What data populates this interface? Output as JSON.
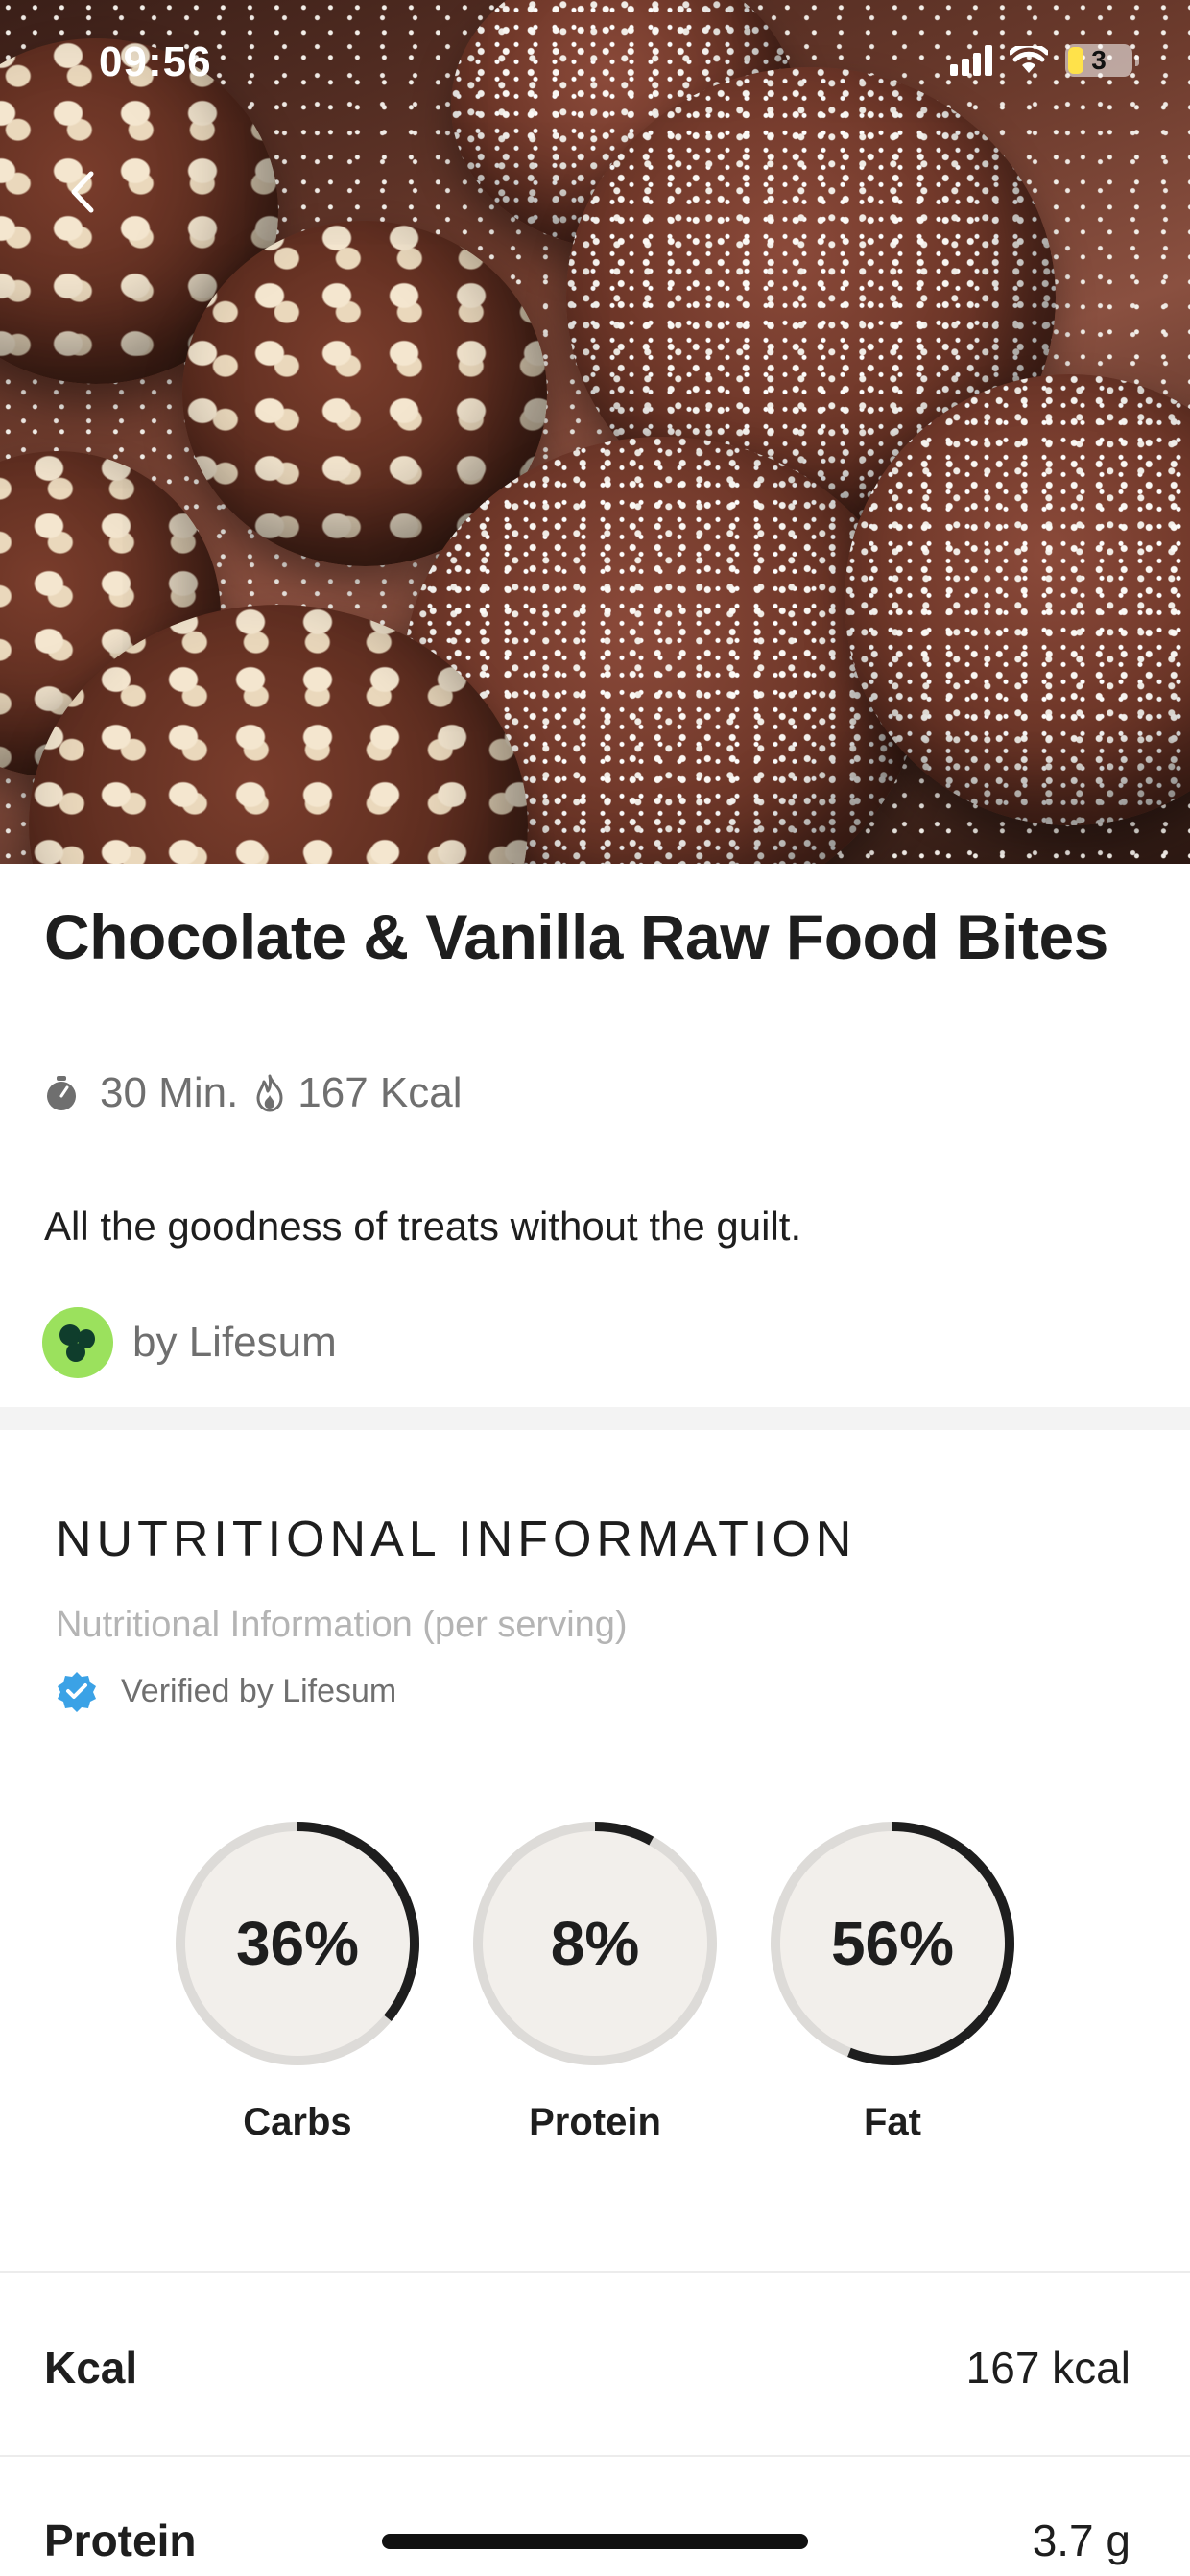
{
  "status_bar": {
    "time": "09:56",
    "battery_level": "3"
  },
  "recipe": {
    "title": "Chocolate & Vanilla Raw Food Bites",
    "time": "30 Min.",
    "calories": "167 Kcal",
    "description": "All the goodness of treats without the guilt.",
    "author": "by Lifesum"
  },
  "nutrition": {
    "heading": "NUTRITIONAL INFORMATION",
    "subtitle": "Nutritional Information (per serving)",
    "verified_label": "Verified by Lifesum",
    "macros": [
      {
        "label": "Carbs",
        "display": "36%",
        "percent": 36
      },
      {
        "label": "Protein",
        "display": "8%",
        "percent": 8
      },
      {
        "label": "Fat",
        "display": "56%",
        "percent": 56
      }
    ],
    "rows": [
      {
        "label": "Kcal",
        "value": "167 kcal"
      },
      {
        "label": "Protein",
        "value": "3.7 g"
      }
    ]
  },
  "colors": {
    "ring_track": "#dddbd8",
    "ring_fill": "#1e1e1e",
    "ring_center": "#f2efeb",
    "verified_badge": "#3ba2e6",
    "author_logo_bg": "#9be15d"
  },
  "icons": {
    "back": "chevron-left-icon",
    "timer": "stopwatch-icon",
    "calories": "flame-icon",
    "verified": "verified-badge-icon",
    "author": "lifesum-logo-icon"
  }
}
